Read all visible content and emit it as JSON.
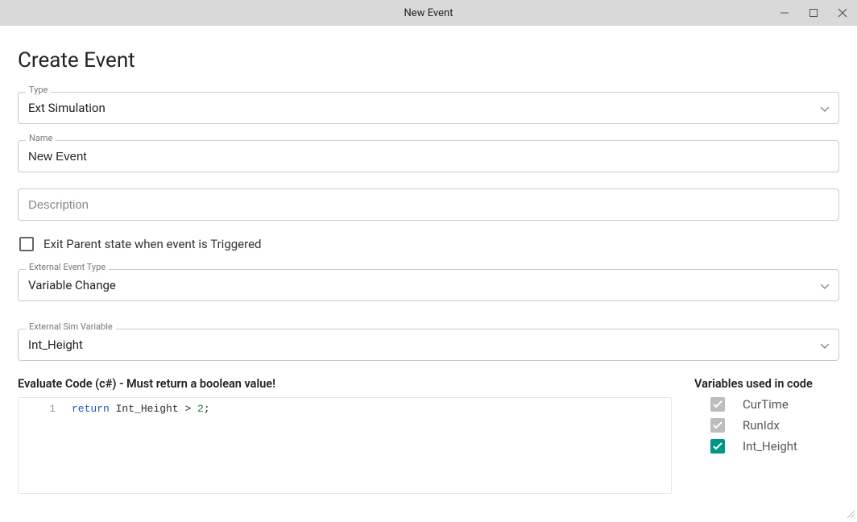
{
  "window": {
    "title": "New Event"
  },
  "page": {
    "heading": "Create Event"
  },
  "fields": {
    "type": {
      "label": "Type",
      "value": "Ext Simulation"
    },
    "name": {
      "label": "Name",
      "value": "New Event"
    },
    "description": {
      "label": "",
      "placeholder": "Description",
      "value": ""
    },
    "exit_parent": {
      "label": "Exit Parent state when event is Triggered",
      "checked": false
    },
    "ext_event_type": {
      "label": "External Event Type",
      "value": "Variable Change"
    },
    "ext_sim_var": {
      "label": "External Sim Variable",
      "value": "Int_Height"
    }
  },
  "evaluate": {
    "title": "Evaluate Code (c#) - Must return a boolean value!",
    "lines": [
      {
        "num": "1",
        "tokens": [
          {
            "t": "return",
            "k": "kw"
          },
          {
            "t": " ",
            "k": "sp"
          },
          {
            "t": "Int_Height",
            "k": "id"
          },
          {
            "t": " > ",
            "k": "id"
          },
          {
            "t": "2",
            "k": "num"
          },
          {
            "t": ";",
            "k": "id"
          }
        ]
      }
    ]
  },
  "variables_panel": {
    "title": "Variables used in code",
    "items": [
      {
        "name": "CurTime",
        "checked": true,
        "disabled": true
      },
      {
        "name": "RunIdx",
        "checked": true,
        "disabled": true
      },
      {
        "name": "Int_Height",
        "checked": true,
        "disabled": false
      }
    ]
  }
}
